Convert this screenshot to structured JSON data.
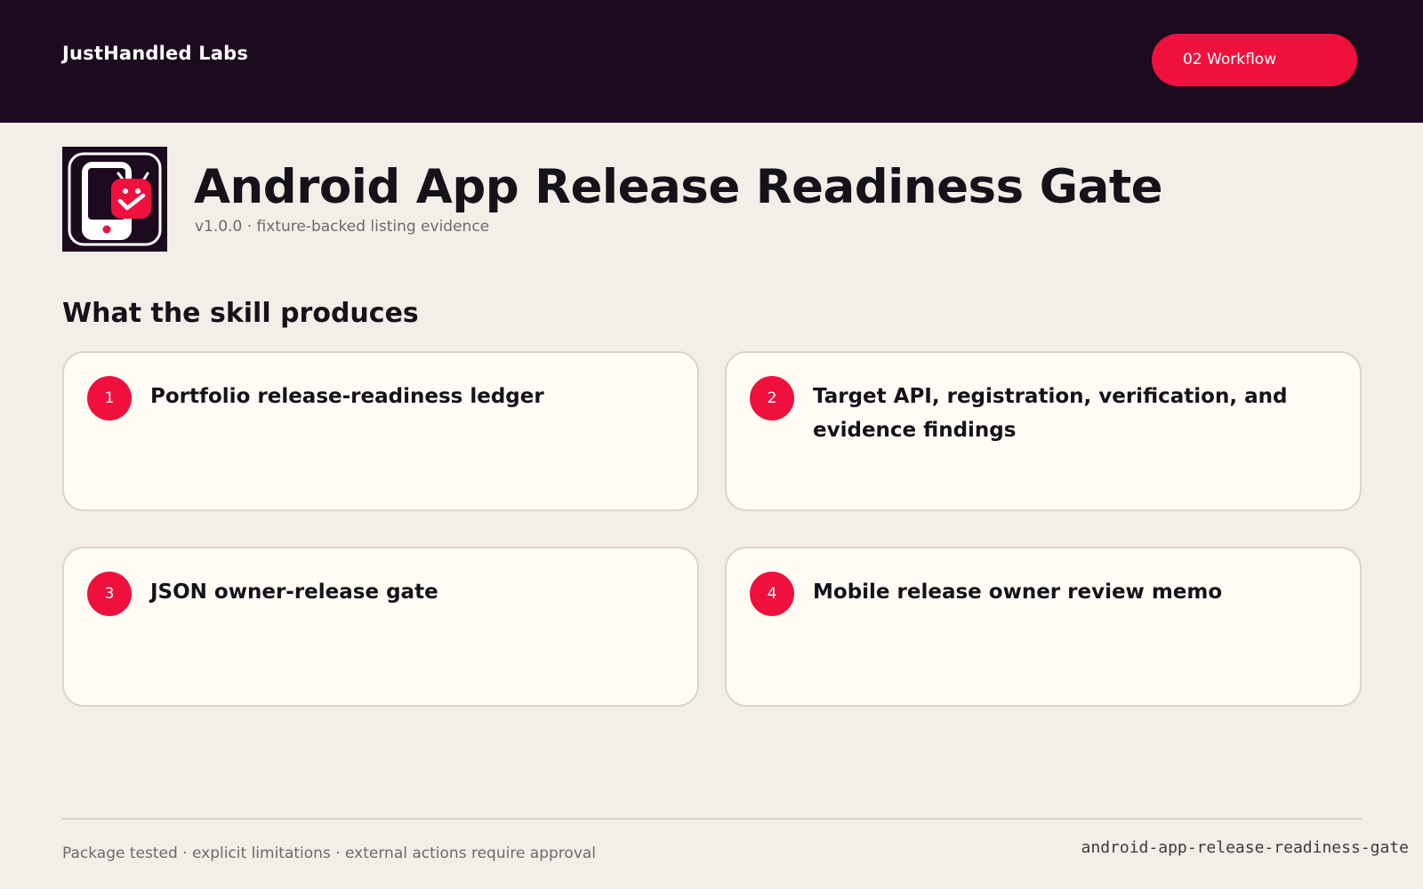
{
  "header": {
    "brand": "JustHandled Labs",
    "workflow_label": "02 Workflow"
  },
  "colors": {
    "topbar_bg": "#1c0a1f",
    "accent": "#f0103e",
    "page_bg": "#f2efe9",
    "card_bg": "#fefcf5"
  },
  "app": {
    "icon": "phone-check-icon",
    "title": "Android App Release Readiness Gate",
    "subtitle": "v1.0.0 · fixture-backed listing evidence"
  },
  "section": {
    "title": "What the skill produces"
  },
  "outputs": [
    {
      "number": "1",
      "label": "Portfolio release-readiness ledger"
    },
    {
      "number": "2",
      "label": "Target API, registration, verification, and evidence findings"
    },
    {
      "number": "3",
      "label": "JSON owner-release gate"
    },
    {
      "number": "4",
      "label": "Mobile release owner review memo"
    }
  ],
  "footer": {
    "note": "Package tested · explicit limitations · external actions require approval",
    "slug": "android-app-release-readiness-gate"
  }
}
